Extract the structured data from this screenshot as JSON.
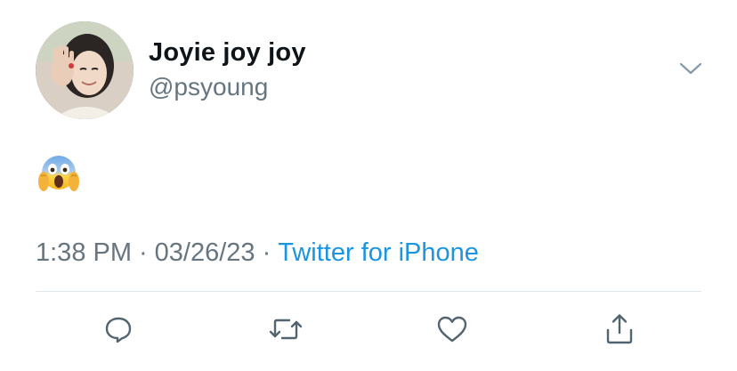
{
  "tweet": {
    "author": {
      "display_name": "Joyie joy joy",
      "handle": "@psyoung"
    },
    "text_emoji": "😱",
    "meta": {
      "time": "1:38 PM",
      "separator": "·",
      "date": "03/26/23",
      "source": "Twitter for iPhone"
    },
    "icons": {
      "menu": "chevron-down-icon",
      "reply": "reply-icon",
      "retweet": "retweet-icon",
      "like": "heart-icon",
      "share": "share-icon"
    }
  },
  "colors": {
    "text_primary": "#0f1419",
    "text_secondary": "#66757f",
    "link": "#1b95e0",
    "divider": "#e1e8ed",
    "icon": "#536471"
  }
}
